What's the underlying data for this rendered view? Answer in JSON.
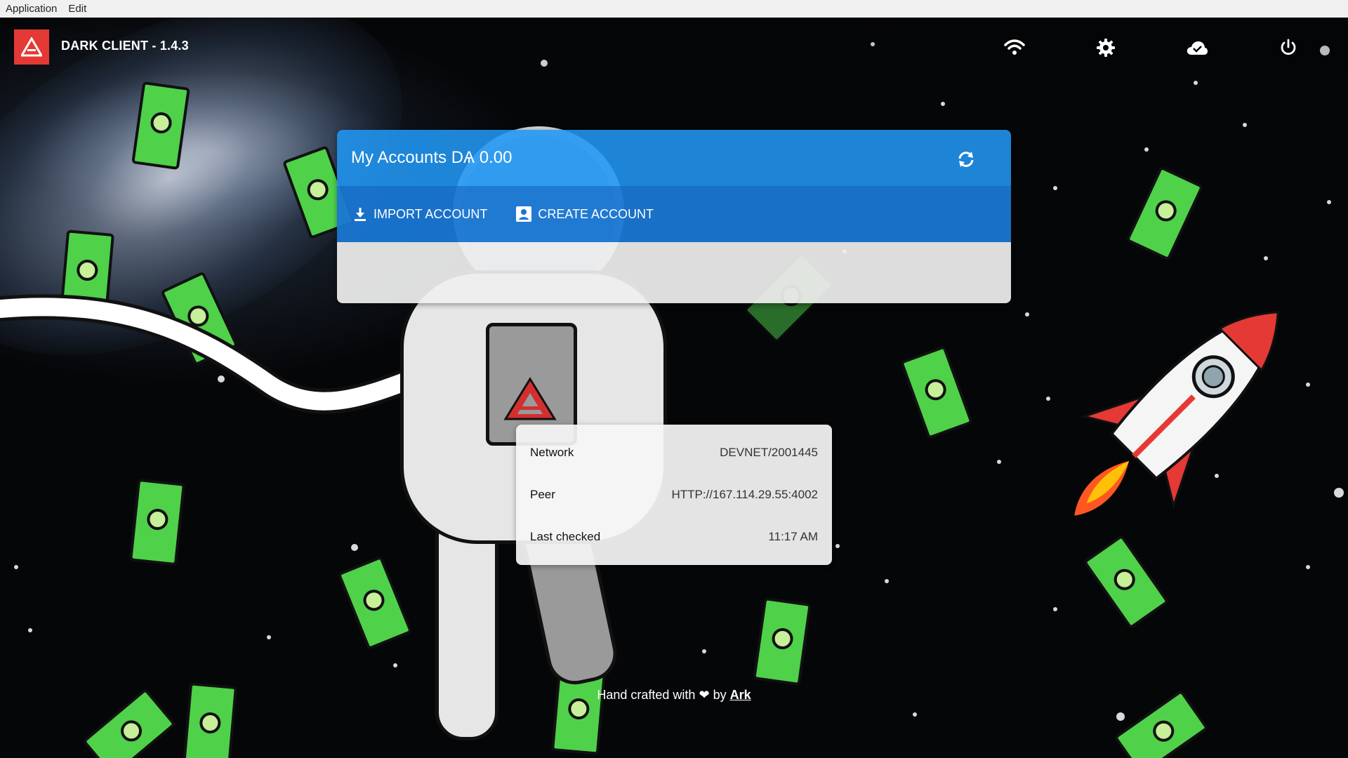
{
  "menubar": {
    "items": [
      "Application",
      "Edit"
    ]
  },
  "app": {
    "title": "DARK CLIENT - 1.4.3"
  },
  "header_icons": [
    "wifi-icon",
    "gear-icon",
    "cloud-check-icon",
    "power-icon"
  ],
  "accounts": {
    "title": "My Accounts DѦ 0.00",
    "import_label": "IMPORT ACCOUNT",
    "create_label": "CREATE ACCOUNT"
  },
  "network": {
    "rows": [
      {
        "label": "Network",
        "value": "DEVNET/2001445"
      },
      {
        "label": "Peer",
        "value": "HTTP://167.114.29.55:4002"
      },
      {
        "label": "Last checked",
        "value": "11:17 AM"
      }
    ]
  },
  "footer": {
    "text_before": "Hand crafted with",
    "text_by": "by",
    "link": "Ark"
  },
  "colors": {
    "accent": "#2196f3",
    "toolbar": "#1976d2",
    "brand": "#e53935"
  }
}
